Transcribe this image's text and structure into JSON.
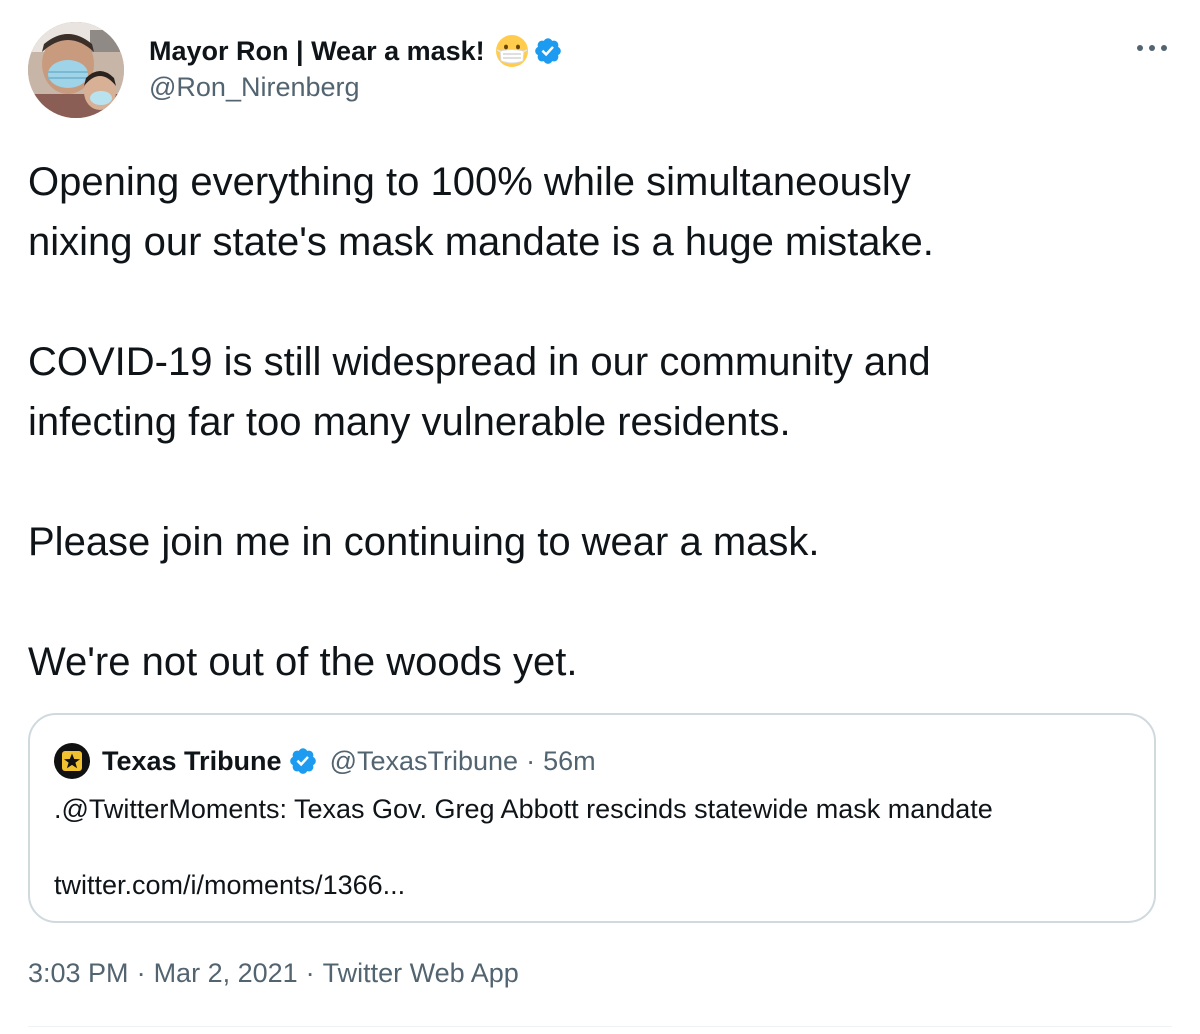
{
  "tweet": {
    "author": {
      "display_name": "Mayor Ron | Wear a mask!",
      "handle": "@Ron_Nirenberg",
      "avatar_icon": "profile-photo-masked",
      "badge_icons": [
        "face-with-medical-mask-emoji",
        "verified-badge-icon"
      ]
    },
    "more_icon": "more-horizontal-icon",
    "body_paragraphs": [
      "Opening everything to 100% while simultaneously\nnixing our state's mask mandate is a huge mistake.",
      "COVID-19 is still widespread in our community and\ninfecting far too many vulnerable residents.",
      "Please join me in continuing to wear a mask.",
      "We're not out of the woods yet."
    ],
    "quoted_tweet": {
      "author_name": "Texas Tribune",
      "handle": "@TexasTribune",
      "separator": "·",
      "time": "56m",
      "text": ".@TwitterMoments: Texas Gov. Greg Abbott rescinds statewide mask mandate",
      "link": "twitter.com/i/moments/1366..."
    },
    "meta": {
      "time": "3:03 PM",
      "separator": "·",
      "date": "Mar 2, 2021",
      "source": "Twitter Web App"
    }
  },
  "colors": {
    "text_primary": "#0f1419",
    "text_secondary": "#536471",
    "verified_blue": "#1d9bf0",
    "border": "#cfd9de"
  }
}
